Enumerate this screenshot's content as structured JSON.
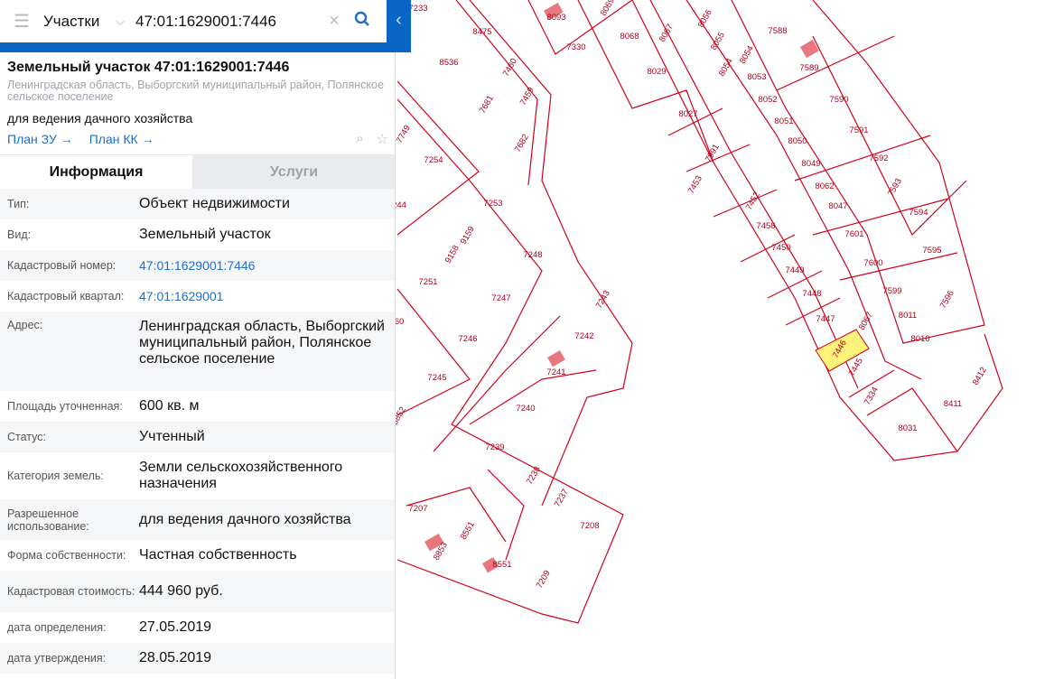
{
  "search": {
    "layer": "Участки",
    "query": "47:01:1629001:7446"
  },
  "card": {
    "title": "Земельный участок 47:01:1629001:7446",
    "address": "Ленинградская область, Выборгский муниципальный район, Полянское сельское поселение",
    "purpose": "для ведения дачного хозяйства",
    "links": [
      {
        "label": "План ЗУ →"
      },
      {
        "label": "План КК →"
      }
    ]
  },
  "tabs": [
    {
      "label": "Информация",
      "active": true
    },
    {
      "label": "Услуги",
      "active": false
    }
  ],
  "rows": [
    {
      "label": "Тип:",
      "value": "Объект недвижимости"
    },
    {
      "label": "Вид:",
      "value": "Земельный участок"
    },
    {
      "label": "Кадастровый номер:",
      "value": "47:01:1629001:7446",
      "link": true
    },
    {
      "label": "Кадастровый квартал:",
      "value": "47:01:1629001",
      "link": true
    },
    {
      "label": "Адрес:",
      "value": "Ленинградская область, Выборгский муниципальный район, Полянское сельское поселение"
    },
    {
      "label": "Площадь уточненная:",
      "value": "600 кв. м"
    },
    {
      "label": "Статус:",
      "value": "Учтенный"
    },
    {
      "label": "Категория земель:",
      "value": "Земли сельскохозяйственного назначения"
    },
    {
      "label": "Разрешенное использование:",
      "value": "для ведения дачного хозяйства"
    },
    {
      "label": "Форма собственности:",
      "value": "Частная собственность"
    },
    {
      "label": "Кадастровая стоимость:",
      "value": "444 960 руб."
    },
    {
      "label": "дата определения:",
      "value": "27.05.2019"
    },
    {
      "label": "дата утверждения:",
      "value": "28.05.2019"
    }
  ],
  "map": {
    "parcel_color": "#d0021b",
    "highlight_fill": "#fff27a",
    "building_color": "#e8777e",
    "selected": "7446",
    "parcels": [
      "7233",
      "8475",
      "8093",
      "8069",
      "8067",
      "8056",
      "8055",
      "7588",
      "8536",
      "7460",
      "7330",
      "8068",
      "8054",
      "8054",
      "8053",
      "7589",
      "7681",
      "7459",
      "8029",
      "8027",
      "8052",
      "7590",
      "7749",
      "7682",
      "8051",
      "7591",
      "7254",
      "7991",
      "7453",
      "8050",
      "8049",
      "7592",
      "8062",
      "7593",
      "7253",
      "7452",
      "8047",
      "7594",
      "9159",
      "7458",
      "7601",
      "9158",
      "7248",
      "7450",
      "7595",
      "7600",
      "7251",
      "7247",
      "7243",
      "7449",
      "7448",
      "7599",
      "7596",
      "8011",
      "7447",
      "8067",
      "7246",
      "7242",
      "8010",
      "7446",
      "7245",
      "7241",
      "7445",
      "8412",
      "7334",
      "7240",
      "8411",
      "8031",
      "7239",
      "7238",
      "7237",
      "7207",
      "8551",
      "7208",
      "8853",
      "8551",
      "7209",
      "8852",
      "244",
      "60",
      "50"
    ]
  }
}
